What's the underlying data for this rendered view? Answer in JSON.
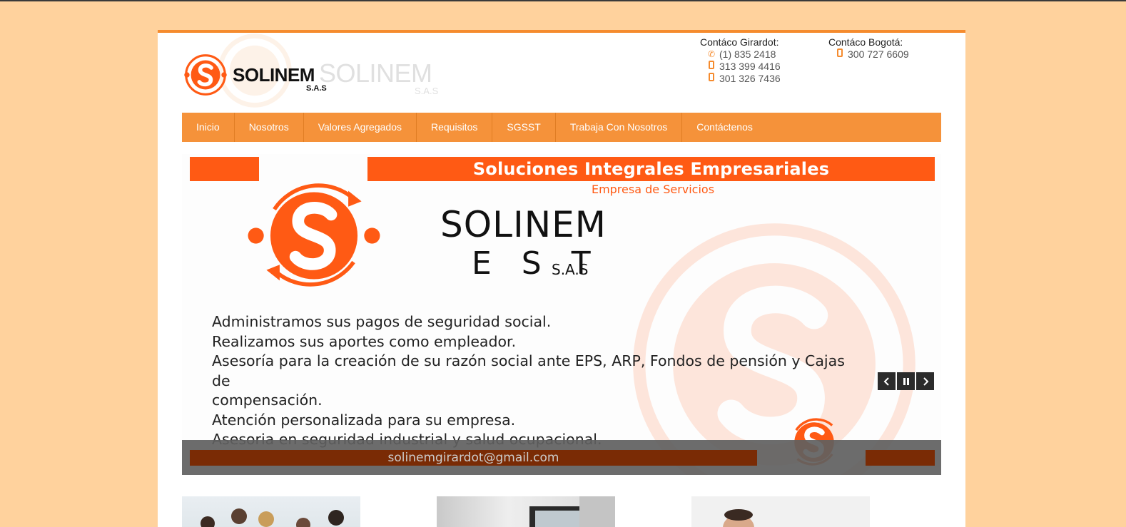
{
  "colors": {
    "background": "#ffd29d",
    "accent": "#f58b2e",
    "slide_orange": "#ff5a14",
    "footer_bar": "#7a2b05"
  },
  "header": {
    "logo_name": "SOLINEM",
    "logo_suffix": "S.A.S",
    "contacts": [
      {
        "title": "Contáco Girardot:",
        "phones": [
          {
            "icon": "phone-icon",
            "number": "(1) 835 2418"
          },
          {
            "icon": "mobile-icon",
            "number": "313 399 4416"
          },
          {
            "icon": "mobile-icon",
            "number": "301 326 7436"
          }
        ]
      },
      {
        "title": "Contáco Bogotá:",
        "phones": [
          {
            "icon": "mobile-icon",
            "number": "300 727 6609"
          }
        ]
      }
    ]
  },
  "nav": {
    "items": [
      "Inicio",
      "Nosotros",
      "Valores Agregados",
      "Requisitos",
      "SGSST",
      "Trabaja Con Nosotros",
      "Contáctenos"
    ]
  },
  "slider": {
    "headline": "Soluciones Integrales Empresariales",
    "subheadline": "Empresa de Servicios",
    "brand": "SOLINEM",
    "brand_line2": "E S T",
    "brand_suffix": "S.A.S",
    "lines": [
      "Administramos sus pagos de seguridad social.",
      "Realizamos sus aportes como empleador.",
      "Asesoría para la creación de su razón social ante EPS, ARP, Fondos de pensión y Cajas de",
      "compensación.",
      "Atención personalizada para su empresa.",
      "Asesoria en seguridad industrial y salud ocupacional."
    ],
    "email": "solinemgirardot@gmail.com",
    "controls": {
      "prev_icon": "chevron-left-icon",
      "pause_icon": "pause-icon",
      "next_icon": "chevron-right-icon"
    }
  }
}
